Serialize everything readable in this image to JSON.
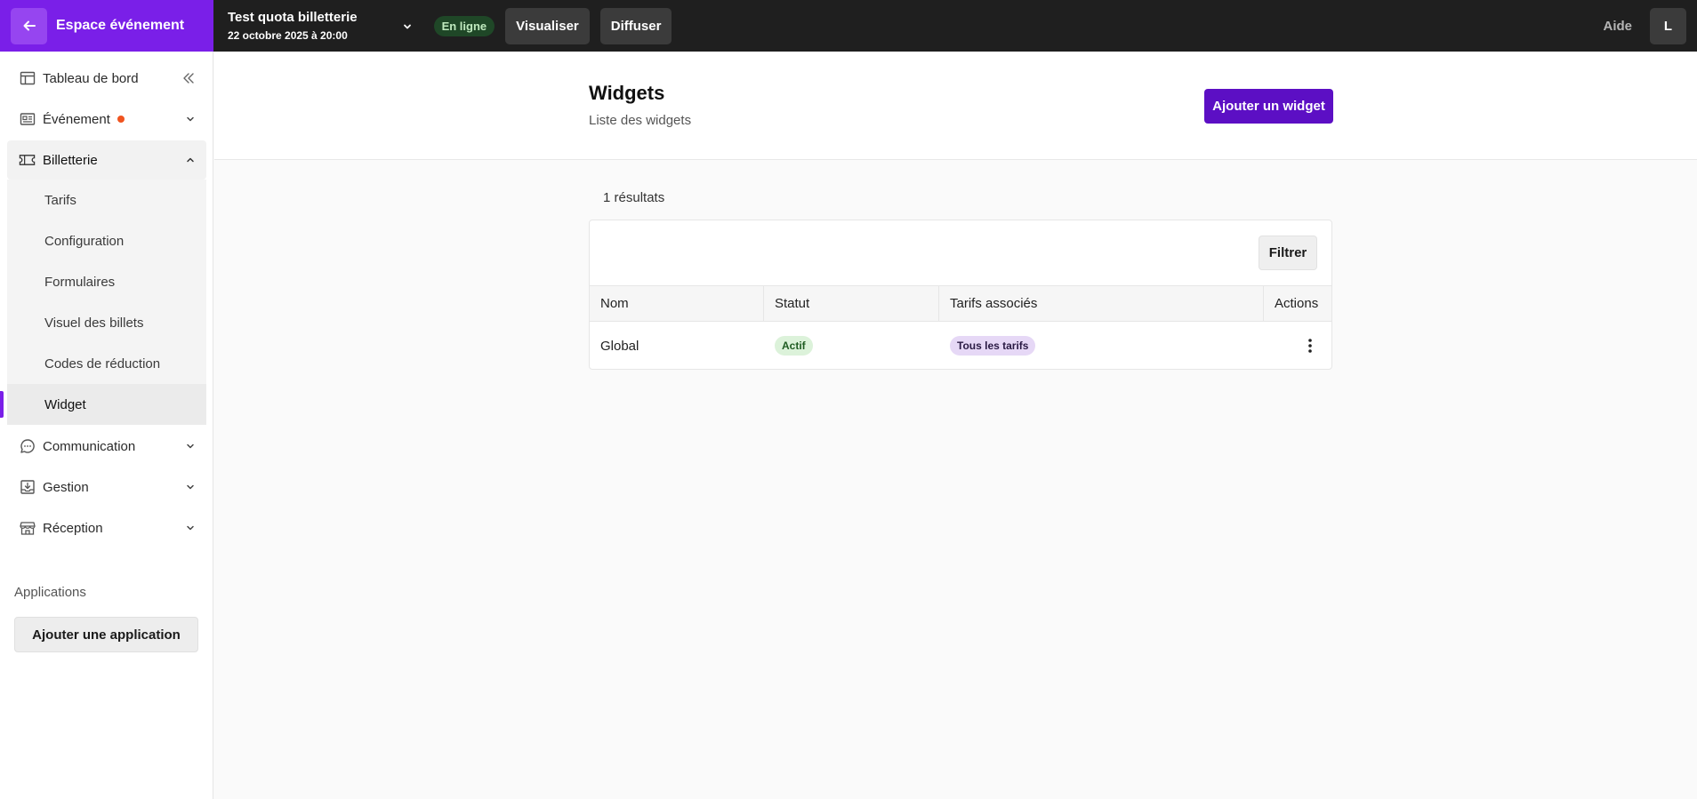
{
  "topbar": {
    "brand_label": "Espace événement",
    "event_title": "Test quota billetterie",
    "event_date": "22 octobre 2025 à 20:00",
    "status": "En ligne",
    "preview_label": "Visualiser",
    "publish_label": "Diffuser",
    "help_label": "Aide",
    "user_initial": "L"
  },
  "sidebar": {
    "items": [
      {
        "label": "Tableau de bord",
        "icon": "dashboard-icon"
      },
      {
        "label": "Événement",
        "icon": "event-card-icon"
      },
      {
        "label": "Billetterie",
        "icon": "ticket-icon"
      },
      {
        "label": "Communication",
        "icon": "chat-bubble-icon"
      },
      {
        "label": "Gestion",
        "icon": "inbox-download-icon"
      },
      {
        "label": "Réception",
        "icon": "storefront-icon"
      }
    ],
    "sub_items": [
      "Tarifs",
      "Configuration",
      "Formulaires",
      "Visuel des billets",
      "Codes de réduction",
      "Widget"
    ],
    "apps_label": "Applications",
    "add_app_label": "Ajouter une application"
  },
  "main": {
    "title": "Widgets",
    "subtitle": "Liste des widgets",
    "add_widget_label": "Ajouter un widget",
    "results_count": "1 résultats",
    "filter_label": "Filtrer",
    "table": {
      "columns": [
        "Nom",
        "Statut",
        "Tarifs associés",
        "Actions"
      ],
      "rows": [
        {
          "name": "Global",
          "status": "Actif",
          "rates": "Tous les tarifs"
        }
      ]
    }
  },
  "colors": {
    "brand": "#7a1fe8",
    "primary_button": "#5c0fc4",
    "topbar": "#1f1f1f",
    "notification_dot": "#f0541f"
  }
}
